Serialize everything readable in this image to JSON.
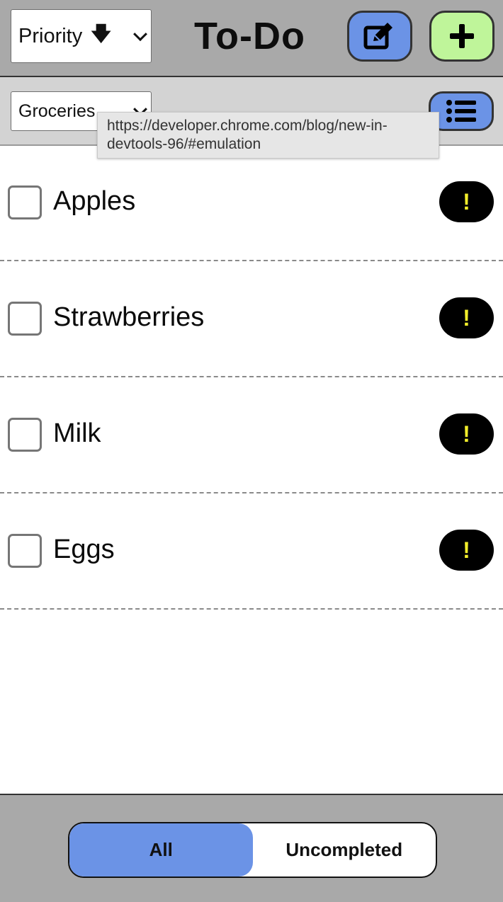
{
  "header": {
    "sort_label": "Priority",
    "sort_arrow": "🡇",
    "title": "To-Do",
    "edit_icon": "edit-icon",
    "add_icon": "plus-icon"
  },
  "subheader": {
    "list_label": "Groceries",
    "list_icon": "list-icon"
  },
  "tooltip": {
    "text": "https://developer.chrome.com/blog/new-in-\ndevtools-96/#emulation"
  },
  "items": [
    {
      "label": "Apples",
      "priority": "!"
    },
    {
      "label": "Strawberries",
      "priority": "!"
    },
    {
      "label": "Milk",
      "priority": "!"
    },
    {
      "label": "Eggs",
      "priority": "!"
    }
  ],
  "filter": {
    "all_label": "All",
    "uncompleted_label": "Uncompleted",
    "active": "All"
  },
  "colors": {
    "accent_blue": "#6b93e6",
    "accent_green": "#bff59a",
    "priority_yellow": "#f2ee2b"
  }
}
